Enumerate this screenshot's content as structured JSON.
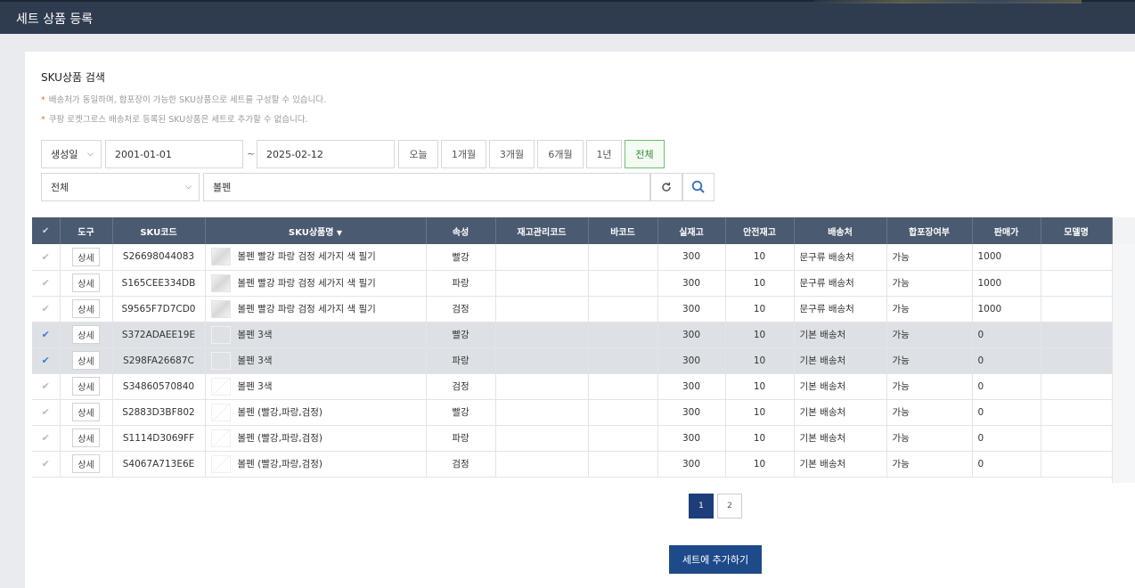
{
  "header": {
    "title": "세트 상품 등록"
  },
  "search": {
    "section_title": "SKU상품 검색",
    "notes": [
      "배송처가 동일하며, 합포장이 가능한 SKU상품으로 세트를 구성할 수 있습니다.",
      "쿠팡 로켓그로스 배송처로 등록된 SKU상품은 세트로 추가할 수 없습니다."
    ],
    "date_type": "생성일",
    "start_date": "2001-01-01",
    "tilde": "~",
    "end_date": "2025-02-12",
    "periods": [
      "오늘",
      "1개월",
      "3개월",
      "6개월",
      "1년",
      "전체"
    ],
    "active_period": "전체",
    "field_select": "전체",
    "keyword": "볼펜"
  },
  "table": {
    "columns": [
      "도구",
      "SKU코드",
      "SKU상품명",
      "속성",
      "재고관리코드",
      "바코드",
      "실재고",
      "안전재고",
      "배송처",
      "합포장여부",
      "판매가",
      "모델명"
    ],
    "sort_indicator": "▼",
    "detail_label": "상세",
    "rows": [
      {
        "selected": false,
        "sku": "S26698044083",
        "name": "볼펜 빨강 파랑 검정 세가지 색 필기",
        "attr": "빨강",
        "stock_code": "",
        "barcode": "",
        "stock": "300",
        "safety": "10",
        "ship": "문구류 배송처",
        "pack": "가능",
        "price": "1000",
        "model": "",
        "thumb": true
      },
      {
        "selected": false,
        "sku": "S165CEE334DB",
        "name": "볼펜 빨강 파랑 검정 세가지 색 필기",
        "attr": "파랑",
        "stock_code": "",
        "barcode": "",
        "stock": "300",
        "safety": "10",
        "ship": "문구류 배송처",
        "pack": "가능",
        "price": "1000",
        "model": "",
        "thumb": true
      },
      {
        "selected": false,
        "sku": "S9565F7D7CD0",
        "name": "볼펜 빨강 파랑 검정 세가지 색 필기",
        "attr": "검정",
        "stock_code": "",
        "barcode": "",
        "stock": "300",
        "safety": "10",
        "ship": "문구류 배송처",
        "pack": "가능",
        "price": "1000",
        "model": "",
        "thumb": true
      },
      {
        "selected": true,
        "sku": "S372ADAEE19E",
        "name": "볼펜 3색",
        "attr": "빨강",
        "stock_code": "",
        "barcode": "",
        "stock": "300",
        "safety": "10",
        "ship": "기본 배송처",
        "pack": "가능",
        "price": "0",
        "model": "",
        "thumb": false
      },
      {
        "selected": true,
        "sku": "S298FA26687C",
        "name": "볼펜 3색",
        "attr": "파랑",
        "stock_code": "",
        "barcode": "",
        "stock": "300",
        "safety": "10",
        "ship": "기본 배송처",
        "pack": "가능",
        "price": "0",
        "model": "",
        "thumb": false
      },
      {
        "selected": false,
        "sku": "S34860570840",
        "name": "볼펜 3색",
        "attr": "검정",
        "stock_code": "",
        "barcode": "",
        "stock": "300",
        "safety": "10",
        "ship": "기본 배송처",
        "pack": "가능",
        "price": "0",
        "model": "",
        "thumb": false
      },
      {
        "selected": false,
        "sku": "S2883D3BF802",
        "name": "볼펜 (빨강,파랑,검정)",
        "attr": "빨강",
        "stock_code": "",
        "barcode": "",
        "stock": "300",
        "safety": "10",
        "ship": "기본 배송처",
        "pack": "가능",
        "price": "0",
        "model": "",
        "thumb": false
      },
      {
        "selected": false,
        "sku": "S1114D3069FF",
        "name": "볼펜 (빨강,파랑,검정)",
        "attr": "파랑",
        "stock_code": "",
        "barcode": "",
        "stock": "300",
        "safety": "10",
        "ship": "기본 배송처",
        "pack": "가능",
        "price": "0",
        "model": "",
        "thumb": false
      },
      {
        "selected": false,
        "sku": "S4067A713E6E",
        "name": "볼펜 (빨강,파랑,검정)",
        "attr": "검정",
        "stock_code": "",
        "barcode": "",
        "stock": "300",
        "safety": "10",
        "ship": "기본 배송처",
        "pack": "가능",
        "price": "0",
        "model": "",
        "thumb": false
      }
    ]
  },
  "pagination": {
    "pages": [
      "1",
      "2"
    ],
    "current": "1"
  },
  "actions": {
    "add_to_set": "세트에 추가하기"
  },
  "colors": {
    "header_bg": "#2f3c4f",
    "table_header": "#4a5a70",
    "primary": "#1e4a8a",
    "selected_row": "#dde1e6",
    "active_period": "#6fbf6f"
  }
}
